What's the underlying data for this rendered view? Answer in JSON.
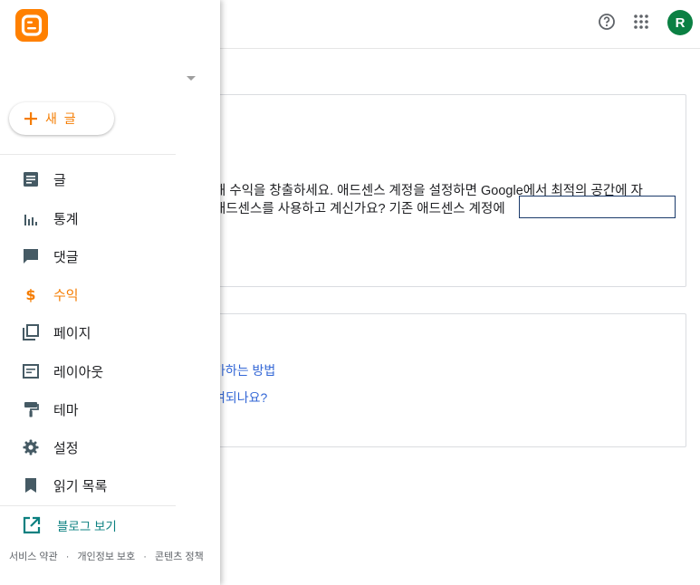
{
  "header": {
    "help_icon": "help-circle-icon",
    "apps_icon": "apps-grid-icon",
    "avatar_letter": "R"
  },
  "drawer": {
    "logo_icon": "blogger-logo",
    "new_post_label": "새 글",
    "nav": [
      {
        "label": "글",
        "icon": "posts-icon",
        "active": false
      },
      {
        "label": "통계",
        "icon": "stats-icon",
        "active": false
      },
      {
        "label": "댓글",
        "icon": "comments-icon",
        "active": false
      },
      {
        "label": "수익",
        "icon": "earnings-icon",
        "active": true
      },
      {
        "label": "페이지",
        "icon": "pages-icon",
        "active": false
      },
      {
        "label": "레이아웃",
        "icon": "layout-icon",
        "active": false
      },
      {
        "label": "테마",
        "icon": "theme-icon",
        "active": false
      },
      {
        "label": "설정",
        "icon": "settings-icon",
        "active": false
      },
      {
        "label": "읽기 목록",
        "icon": "reading-list-icon",
        "active": false
      }
    ],
    "view_blog_label": "블로그 보기",
    "footer": {
      "terms": "서비스 약관",
      "privacy": "개인정보 보호",
      "content_policy": "콘텐츠 정책",
      "separator": "·"
    }
  },
  "main": {
    "adsense_card": {
      "line1": "해 수익을 창출하세요. 애드센스 계정을 설정하면 Google에서 최적의 공간에 자",
      "line2": "애드센스를 사용하고 계신가요? 기존 애드센스 계정에"
    },
    "help_card": {
      "link1": "가하는 방법",
      "link2": "여되나요?"
    }
  },
  "colors": {
    "accent": "#f57c00",
    "avatar_bg": "#0b8043",
    "view_blog": "#0b8080",
    "link": "#3367d6"
  }
}
